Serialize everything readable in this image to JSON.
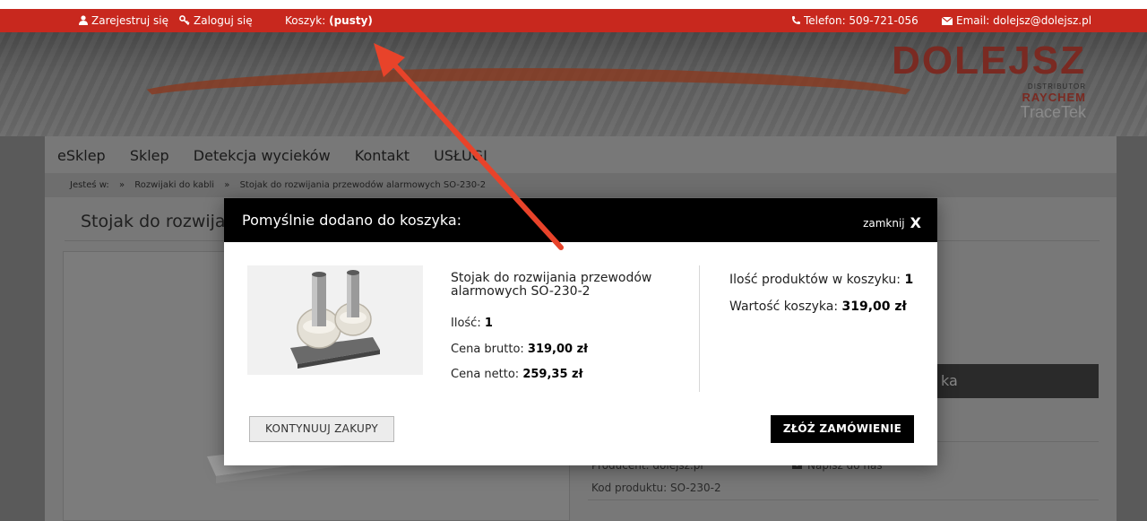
{
  "topbar": {
    "register": "Zarejestruj się",
    "login": "Zaloguj się",
    "cart_label": "Koszyk:",
    "cart_status": "(pusty)",
    "phone": "Telefon: 509-721-056",
    "email": "Email: dolejsz@dolejsz.pl"
  },
  "logo": {
    "line1": "DOLEJSZ",
    "line2": "DISTRIBUTOR",
    "line3": "RAYCHEM",
    "line4": "TraceTek"
  },
  "nav": {
    "items": [
      "eSklep",
      "Sklep",
      "Detekcja wycieków",
      "Kontakt",
      "USŁUGI"
    ]
  },
  "breadcrumb": {
    "prefix": "Jesteś w:",
    "sep": "»",
    "items": [
      "Rozwijaki do kabli",
      "Stojak do rozwijania przewodów alarmowych SO-230-2"
    ]
  },
  "background": {
    "page_title": "Stojak do rozwijan",
    "side_bar_text": "ka",
    "producer": "Producent:  dolejsz.pl",
    "product_code": "Kod produktu:  SO-230-2",
    "write_to_us": "Napisz do nas"
  },
  "modal": {
    "title": "Pomyślnie dodano do koszyka:",
    "close_label": "zamknij",
    "close_x": "X",
    "product_name": "Stojak do rozwijania przewodów alarmowych SO-230-2",
    "qty_label": "Ilość:",
    "qty_value": "1",
    "brutto_label": "Cena brutto:",
    "brutto_value": "319,00 zł",
    "netto_label": "Cena netto:",
    "netto_value": "259,35 zł",
    "cart_count_label": "Ilość produktów w koszyku:",
    "cart_count_value": "1",
    "cart_value_label": "Wartość koszyka:",
    "cart_value_value": "319,00 zł",
    "continue_button": "KONTYNUUJ ZAKUPY",
    "order_button": "ZŁÓŻ ZAMÓWIENIE"
  },
  "colors": {
    "topbar": "#c8281e",
    "arrow": "#e8432a",
    "modal_header": "#000000"
  }
}
